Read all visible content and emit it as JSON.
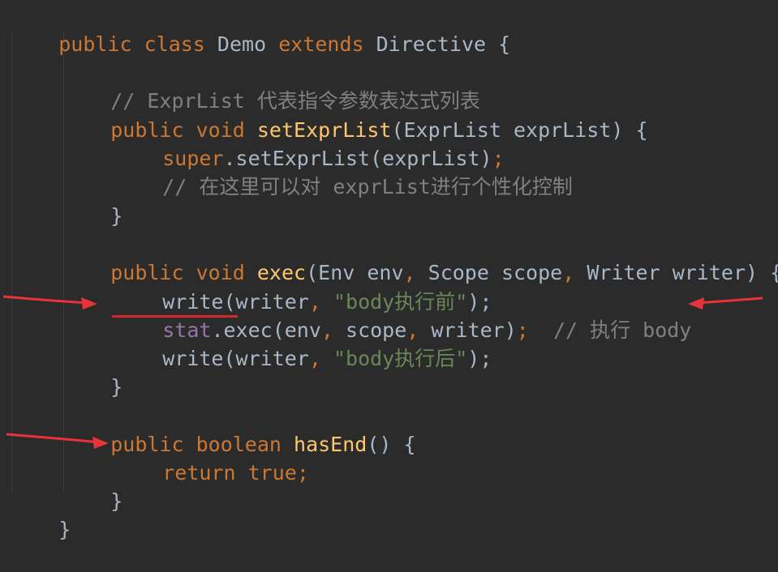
{
  "code": {
    "l1": {
      "public": "public",
      "class": "class",
      "name": "Demo",
      "extends": "extends",
      "parent": "Directive",
      "brace": "{"
    },
    "l3": {
      "comment": "// ExprList 代表指令参数表达式列表"
    },
    "l4": {
      "public": "public",
      "void": "void",
      "method": "setExprList",
      "params": "(ExprList exprList)",
      "brace": "{"
    },
    "l5": {
      "super": "super",
      "call": ".setExprList(exprList)",
      "semi": ";"
    },
    "l6": {
      "comment": "// 在这里可以对 exprList进行个性化控制"
    },
    "l7": {
      "close": "}"
    },
    "l9": {
      "public": "public",
      "void": "void",
      "method": "exec",
      "open": "(Env env",
      "c1": ",",
      "p2": "Scope scope",
      "c2": ",",
      "p3": "Writer writer) {"
    },
    "l10": {
      "call": "write(writer",
      "comma": ",",
      "str": "\"body执行前\"",
      "end": ");"
    },
    "l11": {
      "field": "stat",
      "call": ".exec(env",
      "c1": ",",
      "p2": "scope",
      "c2": ",",
      "p3": "writer)",
      "semi": ";",
      "comment": "// 执行 body"
    },
    "l12": {
      "call": "write(writer",
      "comma": ",",
      "str": "\"body执行后\"",
      "end": ");"
    },
    "l13": {
      "close": "}"
    },
    "l15": {
      "public": "public",
      "boolean": "boolean",
      "method": "hasEnd",
      "rest": "() {"
    },
    "l16": {
      "return": "return",
      "true": "true",
      "semi": ";"
    },
    "l17": {
      "close": "}"
    },
    "l18": {
      "close": "}"
    }
  },
  "colors": {
    "background": "#2b2b2b",
    "keyword": "#cc7832",
    "method": "#ffc66d",
    "string": "#6a8759",
    "comment": "#808080",
    "field": "#9876aa",
    "plain": "#a9b7c6",
    "annotation_red": "#e8333a"
  }
}
